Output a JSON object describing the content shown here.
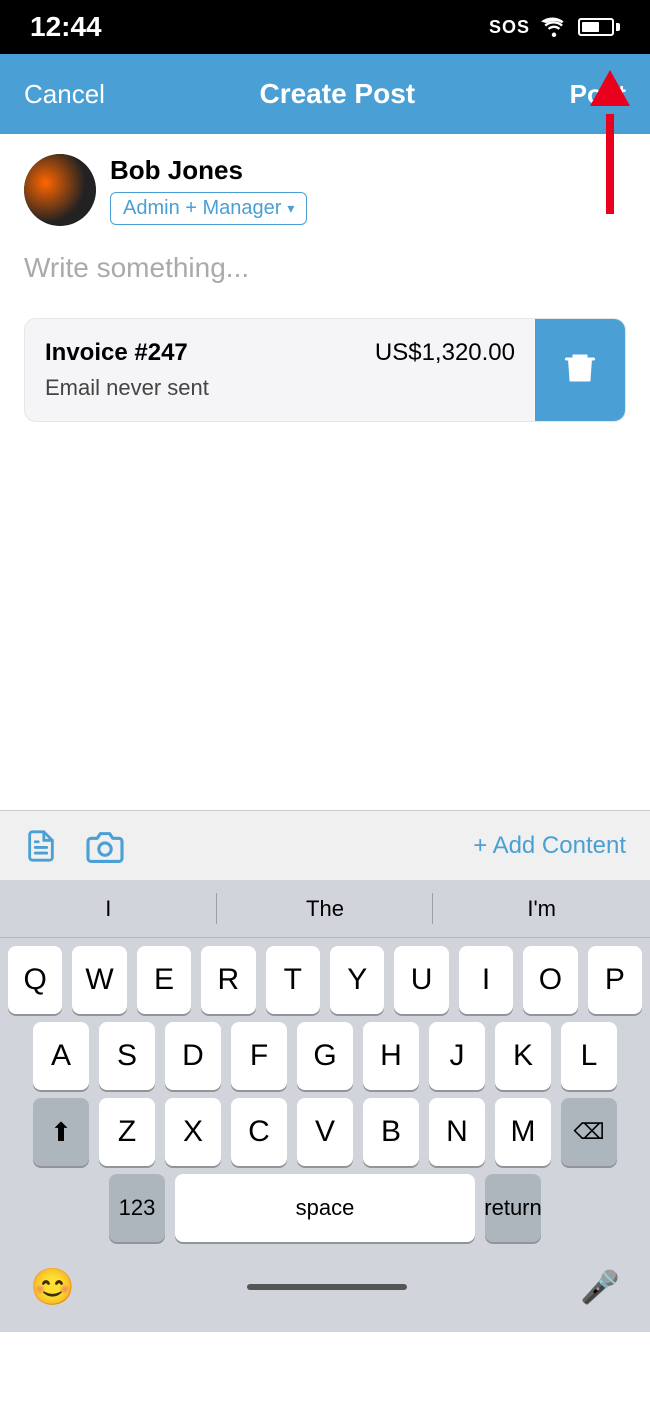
{
  "statusBar": {
    "time": "12:44",
    "icons": [
      "SOS",
      "wifi",
      "battery"
    ]
  },
  "navBar": {
    "cancel": "Cancel",
    "title": "Create Post",
    "post": "Post"
  },
  "user": {
    "name": "Bob Jones",
    "role": "Admin + Manager",
    "roleChevron": "▾"
  },
  "editor": {
    "placeholder": "Write something..."
  },
  "invoice": {
    "number": "Invoice #247",
    "amount": "US$1,320.00",
    "status": "Email never sent",
    "deleteLabel": "delete"
  },
  "toolbar": {
    "docIcon": "📄",
    "cameraIcon": "📷",
    "addContent": "+ Add Content"
  },
  "suggestions": [
    {
      "text": "I"
    },
    {
      "text": "The"
    },
    {
      "text": "I'm"
    }
  ],
  "keyboard": {
    "row1": [
      "Q",
      "W",
      "E",
      "R",
      "T",
      "Y",
      "U",
      "I",
      "O",
      "P"
    ],
    "row2": [
      "A",
      "S",
      "D",
      "F",
      "G",
      "H",
      "J",
      "K",
      "L"
    ],
    "row3": [
      "Z",
      "X",
      "C",
      "V",
      "B",
      "N",
      "M"
    ],
    "spaceLabel": "space",
    "returnLabel": "return",
    "numLabel": "123"
  },
  "bottomBar": {
    "emojiIcon": "😊",
    "micIcon": "🎤"
  }
}
